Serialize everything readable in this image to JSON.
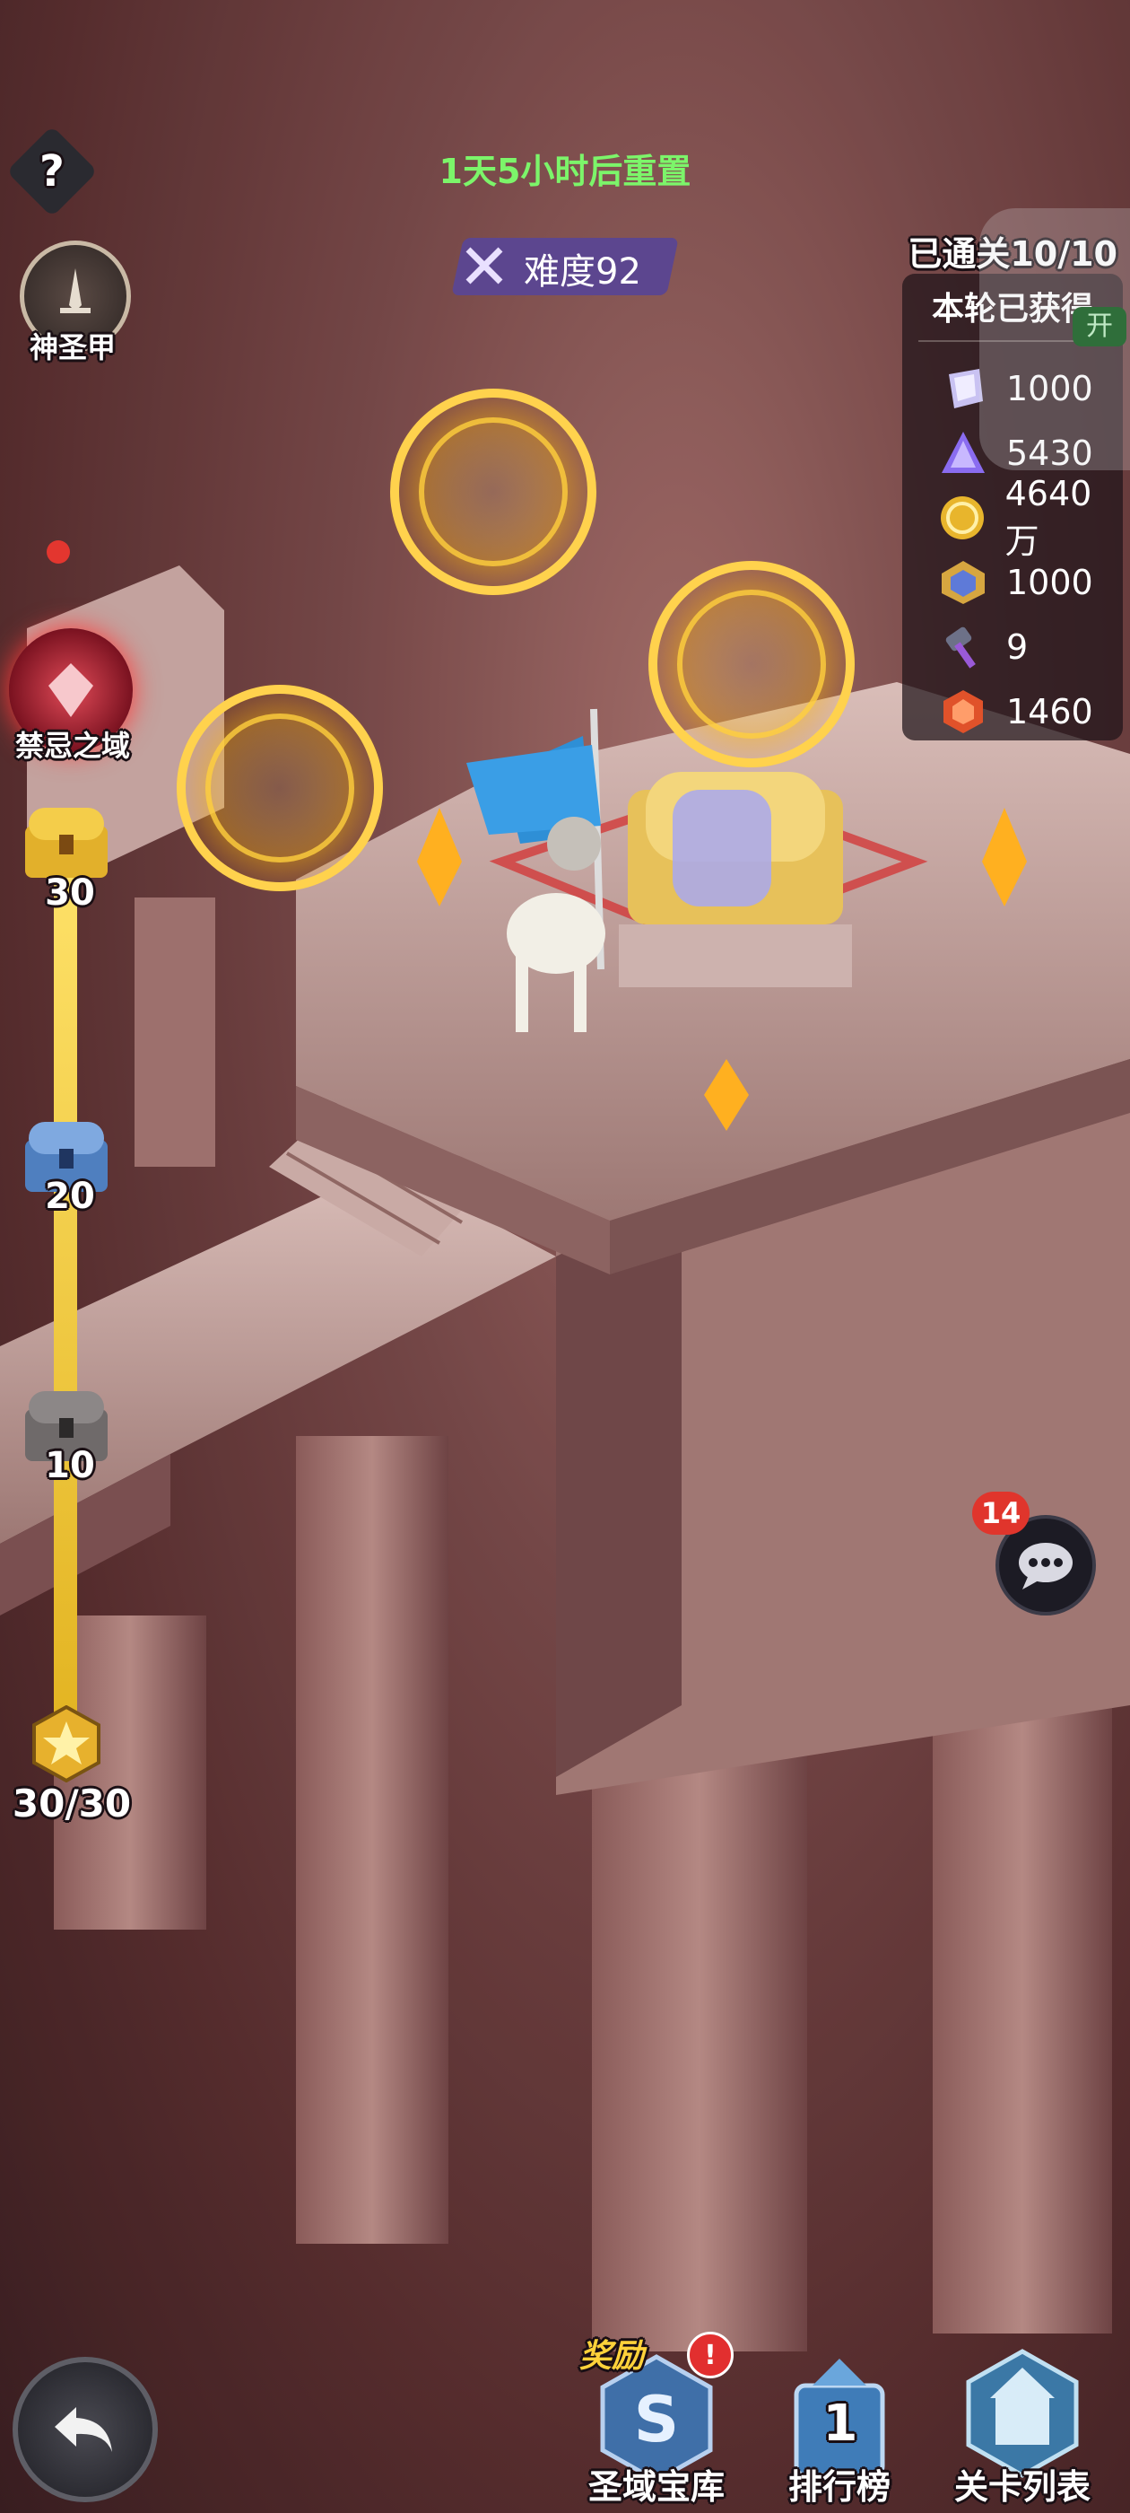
{
  "header": {
    "help_glyph": "?",
    "reset_timer": "1天5小时后重置",
    "difficulty": "难度92"
  },
  "left_menu": {
    "holy_armor_label": "神圣甲",
    "forbidden_domain_label": "禁忌之域"
  },
  "progress": {
    "tiers": [
      {
        "label": "30",
        "icon": "gold-chest-icon"
      },
      {
        "label": "20",
        "icon": "blue-chest-icon"
      },
      {
        "label": "10",
        "icon": "gray-chest-icon"
      }
    ],
    "stars_label": "30/30",
    "star_icon": "star-badge-icon",
    "fill_fraction": 1.0
  },
  "rewards_panel": {
    "cleared": "已通关10/10",
    "title": "本轮已获得",
    "toggle_label": "开",
    "items": [
      {
        "icon": "crystal-shard-icon",
        "value": "1000"
      },
      {
        "icon": "purple-gem-icon",
        "value": "5430"
      },
      {
        "icon": "gold-coin-icon",
        "value": "4640万"
      },
      {
        "icon": "gold-badge-icon",
        "value": "1000"
      },
      {
        "icon": "dark-hammer-icon",
        "value": "9"
      },
      {
        "icon": "orange-rune-icon",
        "value": "1460"
      }
    ]
  },
  "chat": {
    "badge_count": "14"
  },
  "bottom_bar": {
    "reward_tag": "奖励",
    "alert_glyph": "!",
    "buttons": [
      {
        "label": "圣域宝库",
        "icon": "treasury-icon"
      },
      {
        "label": "排行榜",
        "icon": "leaderboard-icon",
        "rank": "1"
      },
      {
        "label": "关卡列表",
        "icon": "stage-list-icon"
      }
    ]
  },
  "colors": {
    "timer_green": "#7cf56a",
    "progress_gold": "#f2d23a",
    "difficulty_purple": "#6b4fb3"
  }
}
